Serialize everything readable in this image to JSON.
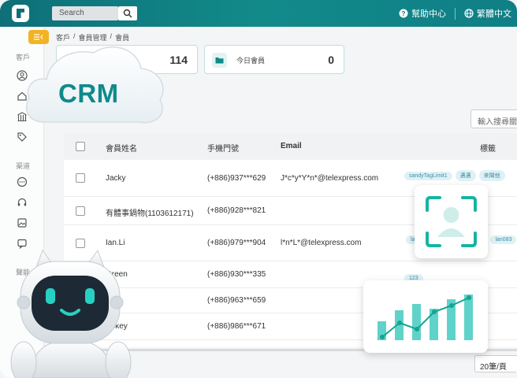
{
  "topbar": {
    "search_placeholder": "Search",
    "help_label": "幫助中心",
    "language_label": "繁體中文"
  },
  "sidebar": {
    "section_customers": "客戶",
    "section_channels": "渠道",
    "section_other": "聲能"
  },
  "breadcrumb": [
    "客戶",
    "/",
    "會員管理",
    "/",
    "會員"
  ],
  "stats": [
    {
      "label": "",
      "value": "114"
    },
    {
      "label": "今日會員",
      "value": "0"
    }
  ],
  "member_search_placeholder": "輸入搜尋關鍵",
  "overlay": {
    "cloud_text": "CRM"
  },
  "table": {
    "headers": {
      "name": "會員姓名",
      "phone": "手機門號",
      "email": "Email",
      "tags": "標籤"
    },
    "rows": [
      {
        "name": "Jacky",
        "phone": "(+886)937***629",
        "email": "J*c*y*Y*n*@telexpress.com",
        "tags": [
          "sandyTagLimit1",
          "邁邁",
          "来聞他"
        ]
      },
      {
        "name": "有體事鍋物(1103612171)",
        "phone": "(+886)928***821",
        "email": "",
        "tags": []
      },
      {
        "name": "Ian.Li",
        "phone": "(+886)979***904",
        "email": "l*n*L*@telexpress.com",
        "tags": [
          "la",
          "lan083"
        ]
      },
      {
        "name": "Green",
        "phone": "(+886)930***335",
        "email": "",
        "tags": [
          "123"
        ]
      },
      {
        "name": "",
        "phone": "(+886)963***659",
        "email": "",
        "tags": []
      },
      {
        "name": "vickey",
        "phone": "(+886)986***671",
        "email": "",
        "tags": []
      }
    ]
  },
  "pagination": {
    "page_size_label": "20筆/頁"
  },
  "colors": {
    "brand_teal": "#0f8a8a",
    "accent_yellow": "#f2b324",
    "chart_bar": "#5fd3c9"
  }
}
